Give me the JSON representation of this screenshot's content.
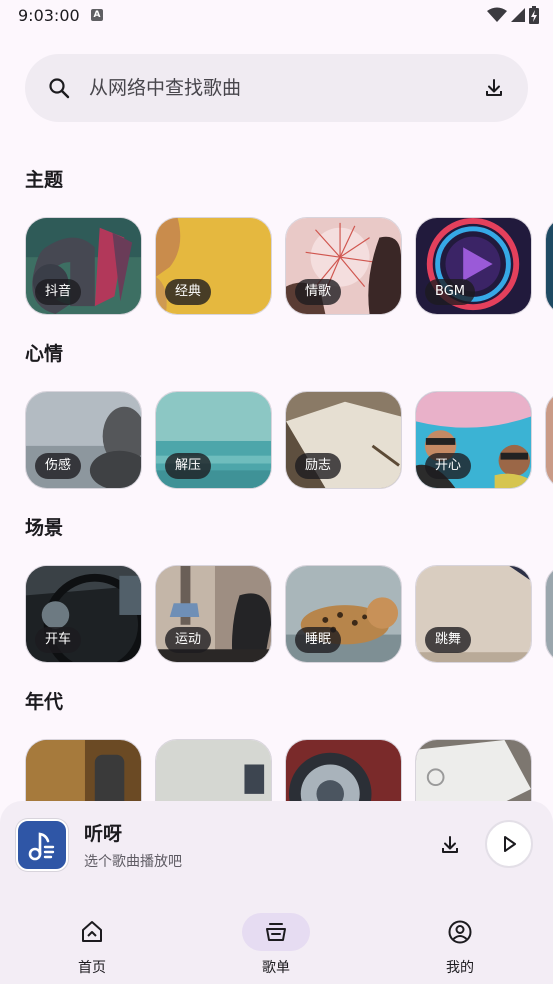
{
  "status_bar": {
    "time": "9:03:00",
    "notification_badge": "A"
  },
  "search": {
    "placeholder": "从网络中查找歌曲"
  },
  "sections": [
    {
      "title": "主题",
      "items": [
        "抖音",
        "经典",
        "情歌",
        "BGM"
      ]
    },
    {
      "title": "心情",
      "items": [
        "伤感",
        "解压",
        "励志",
        "开心"
      ]
    },
    {
      "title": "场景",
      "items": [
        "开车",
        "运动",
        "睡眠",
        "跳舞"
      ]
    },
    {
      "title": "年代",
      "items": [
        "",
        "",
        "",
        ""
      ]
    }
  ],
  "player": {
    "title": "听呀",
    "subtitle": "选个歌曲播放吧"
  },
  "nav": {
    "home": "首页",
    "playlist": "歌单",
    "mine": "我的",
    "active": "歌单"
  },
  "colors": {
    "accent": "#e6dcf2",
    "background": "#fdf7fd",
    "app_logo": "#2f56a6"
  }
}
